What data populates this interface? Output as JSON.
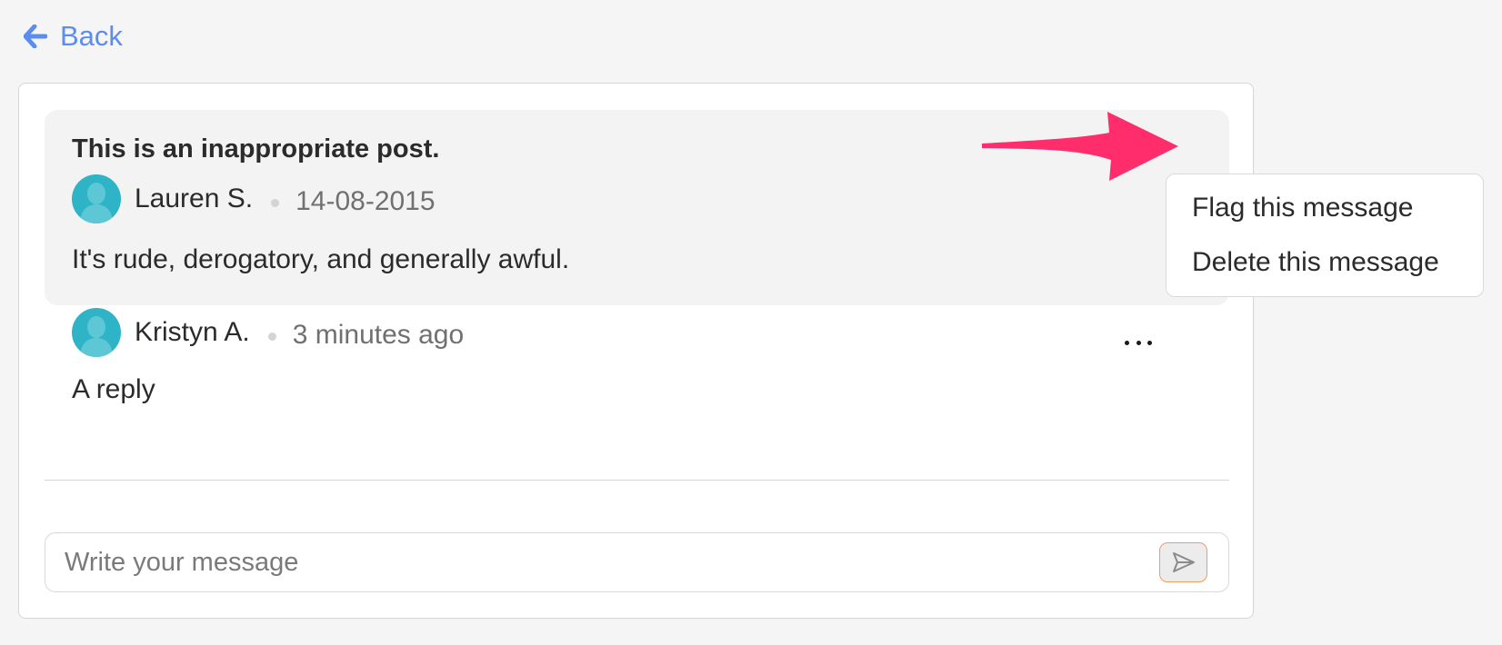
{
  "nav": {
    "back_label": "Back"
  },
  "thread": {
    "main_message": {
      "title": "This is an inappropriate post.",
      "author": "Lauren S.",
      "timestamp": "14-08-2015",
      "body": "It's rude, derogatory, and generally awful."
    },
    "reply": {
      "author": "Kristyn A.",
      "timestamp": "3 minutes ago",
      "body": "A reply"
    }
  },
  "message_menu": {
    "items": [
      {
        "label": "Flag this message"
      },
      {
        "label": "Delete this message"
      }
    ]
  },
  "composer": {
    "placeholder": "Write your message",
    "value": ""
  },
  "icons": {
    "back": "arrow-left-icon",
    "more": "more-horizontal-icon",
    "send": "send-icon",
    "avatar": "user-silhouette-icon"
  },
  "colors": {
    "link": "#5b8dee",
    "avatar": "#2fb3c6",
    "annotation_arrow": "#ff2d6b",
    "send_border": "#f29a62"
  }
}
